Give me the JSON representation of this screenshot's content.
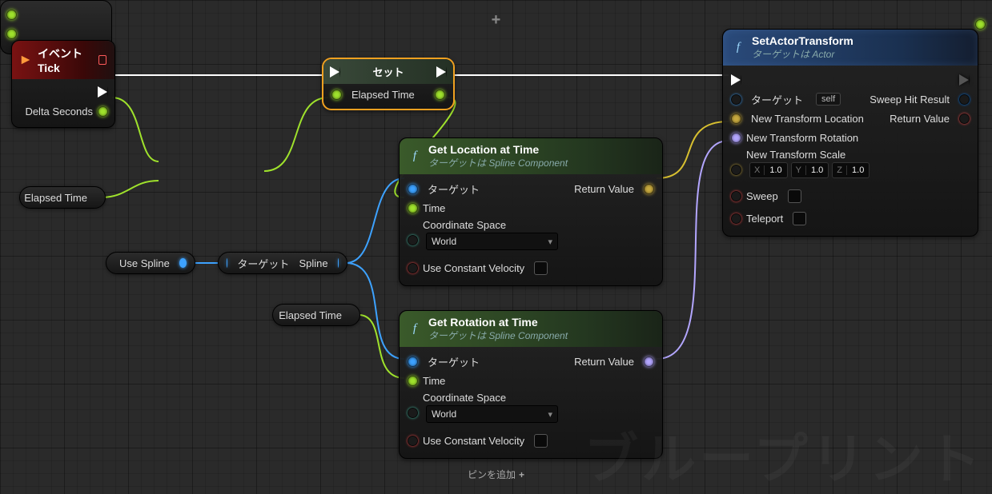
{
  "watermark": "ブループリント",
  "event": {
    "title": "イベント Tick",
    "delta_label": "Delta Seconds"
  },
  "set": {
    "title": "セット",
    "var": "Elapsed Time"
  },
  "add": {
    "sub": "ピンを追加"
  },
  "pills": {
    "elapsed_time_1": "Elapsed Time",
    "use_spline": "Use Spline",
    "target": "ターゲット",
    "spline": "Spline",
    "elapsed_time_2": "Elapsed Time"
  },
  "getloc": {
    "title": "Get Location at Time",
    "subtitle": "ターゲットは Spline Component",
    "pin_target": "ターゲット",
    "pin_time": "Time",
    "coord_label": "Coordinate Space",
    "coord_value": "World",
    "const_vel": "Use Constant Velocity",
    "return": "Return Value"
  },
  "getrot": {
    "title": "Get Rotation at Time",
    "subtitle": "ターゲットは Spline Component",
    "pin_target": "ターゲット",
    "pin_time": "Time",
    "coord_label": "Coordinate Space",
    "coord_value": "World",
    "const_vel": "Use Constant Velocity",
    "return": "Return Value"
  },
  "setx": {
    "title": "SetActorTransform",
    "subtitle": "ターゲットは Actor",
    "pin_target": "ターゲット",
    "self": "self",
    "loc": "New Transform Location",
    "rot": "New Transform Rotation",
    "scale": "New Transform Scale",
    "scale_x": "1.0",
    "scale_y": "1.0",
    "scale_z": "1.0",
    "sweep": "Sweep",
    "teleport": "Teleport",
    "return": "Return Value",
    "sweephit": "Sweep Hit Result"
  }
}
